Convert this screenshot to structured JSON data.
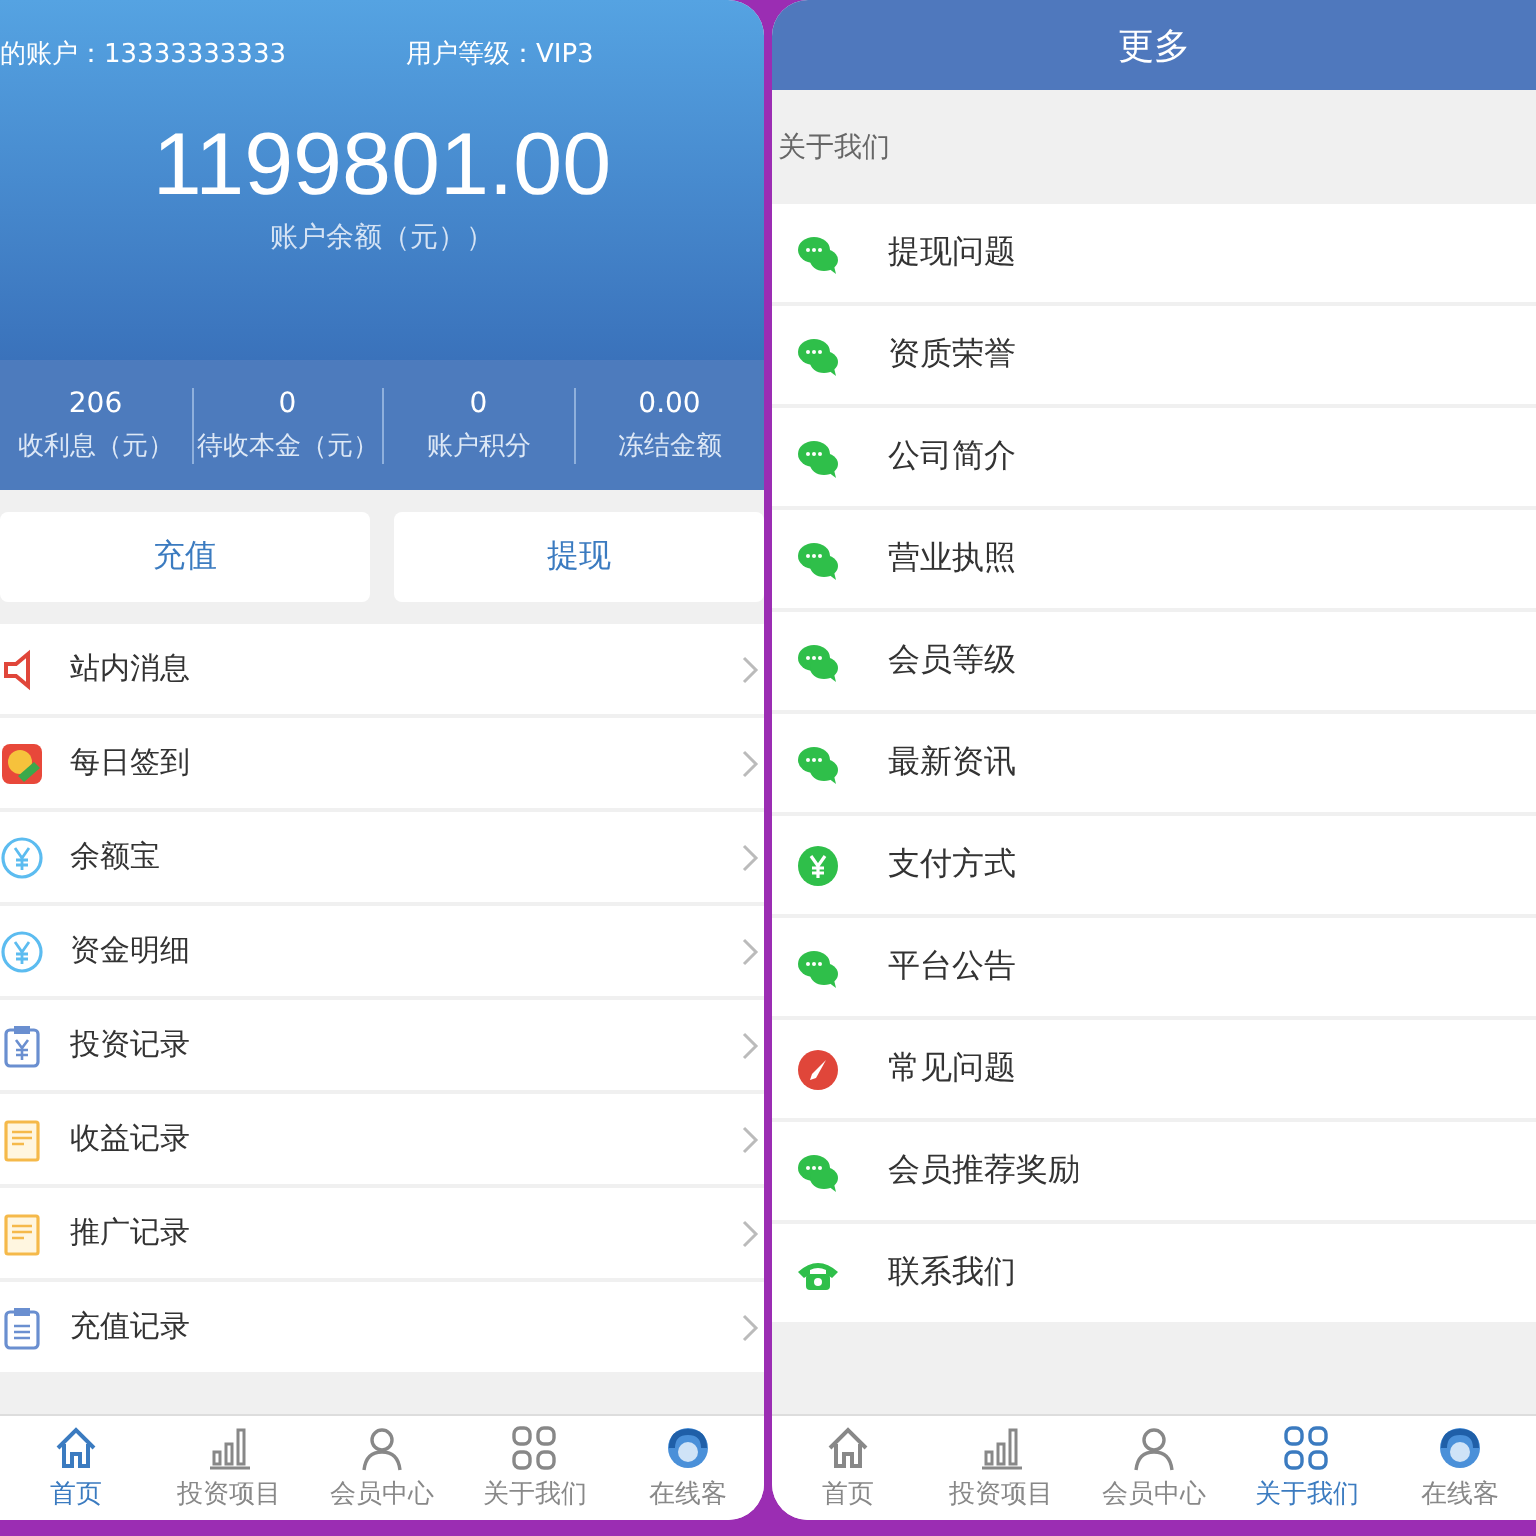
{
  "left_screen": {
    "account": {
      "label": "的账户：13333333333",
      "level_text": "用户等级：VIP3"
    },
    "balance": {
      "amount": "1199801.00",
      "caption": "账户余额（元））"
    },
    "stats": [
      {
        "value": "206",
        "label": "收利息（元）"
      },
      {
        "value": "0",
        "label": "待收本金（元）"
      },
      {
        "value": "0",
        "label": "账户积分"
      },
      {
        "value": "0.00",
        "label": "冻结金额"
      }
    ],
    "actions": [
      "充值",
      "提现"
    ],
    "menu": [
      {
        "kind": "speaker",
        "label": "站内消息"
      },
      {
        "kind": "checkin",
        "label": "每日签到"
      },
      {
        "kind": "yen",
        "label": "余额宝"
      },
      {
        "kind": "yen",
        "label": "资金明细"
      },
      {
        "kind": "yen-clipboard",
        "label": "投资记录"
      },
      {
        "kind": "note",
        "label": "收益记录"
      },
      {
        "kind": "note",
        "label": "推广记录"
      },
      {
        "kind": "clipboard",
        "label": "充值记录"
      }
    ],
    "tab_bar": [
      {
        "kind": "home",
        "label": "首页",
        "selected": true
      },
      {
        "kind": "chart",
        "label": "投资项目",
        "selected": false
      },
      {
        "kind": "person",
        "label": "会员中心",
        "selected": false
      },
      {
        "kind": "grid",
        "label": "关于我们",
        "selected": false
      },
      {
        "kind": "service",
        "label": "在线客",
        "selected": false
      }
    ]
  },
  "right_screen": {
    "title": "更多",
    "section": "关于我们",
    "menu": [
      {
        "kind": "chat",
        "label": "提现问题"
      },
      {
        "kind": "chat",
        "label": "资质荣誉"
      },
      {
        "kind": "chat",
        "label": "公司简介"
      },
      {
        "kind": "chat",
        "label": "营业执照"
      },
      {
        "kind": "chat",
        "label": "会员等级"
      },
      {
        "kind": "chat",
        "label": "最新资讯"
      },
      {
        "kind": "yen-green",
        "label": "支付方式"
      },
      {
        "kind": "chat",
        "label": "平台公告"
      },
      {
        "kind": "compass",
        "label": "常见问题"
      },
      {
        "kind": "chat",
        "label": "会员推荐奖励"
      },
      {
        "kind": "phone",
        "label": "联系我们"
      }
    ],
    "tab_bar": [
      {
        "kind": "home",
        "label": "首页",
        "selected": false
      },
      {
        "kind": "chart",
        "label": "投资项目",
        "selected": false
      },
      {
        "kind": "person",
        "label": "会员中心",
        "selected": false
      },
      {
        "kind": "grid",
        "label": "关于我们",
        "selected": true
      },
      {
        "kind": "service",
        "label": "在线客",
        "selected": false
      }
    ]
  }
}
